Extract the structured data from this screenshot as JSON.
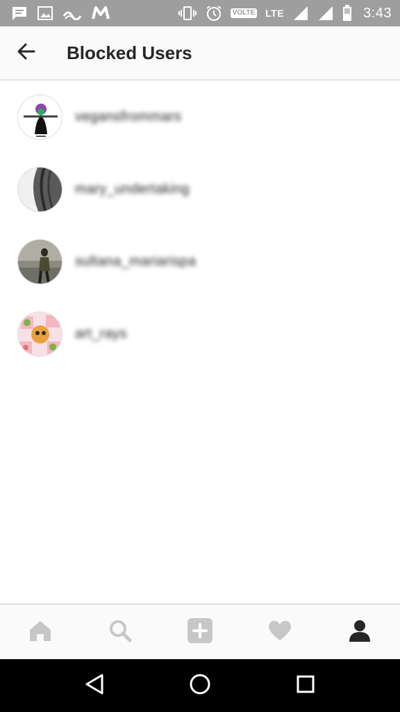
{
  "status_bar": {
    "volte": "VOLTE",
    "network": "LTE",
    "time": "3:43",
    "icons": [
      "message-icon",
      "image-icon",
      "wifi-signal-icon",
      "m-app-icon",
      "vibrate-icon",
      "alarm-icon",
      "signal-icon",
      "signal-icon-2",
      "battery-icon"
    ]
  },
  "app_bar": {
    "title": "Blocked Users",
    "back_icon": "back-arrow-icon"
  },
  "blocked_users": [
    {
      "username": "vegansfrommars",
      "avatar": "avatar-vegansfrommars"
    },
    {
      "username": "mary_undertaking",
      "avatar": "avatar-mary-undertaking"
    },
    {
      "username": "sultana_mariarispa",
      "avatar": "avatar-sultana"
    },
    {
      "username": "art_rays",
      "avatar": "avatar-art-rays"
    }
  ],
  "bottom_nav": {
    "items": [
      "home-icon",
      "search-icon",
      "add-post-icon",
      "heart-icon",
      "profile-icon"
    ],
    "active": "profile-icon"
  },
  "system_nav": {
    "items": [
      "back-triangle-icon",
      "home-circle-icon",
      "recents-square-icon"
    ]
  },
  "colors": {
    "status_bar": "#9e9e9e",
    "app_bar": "#fafafa",
    "text": "#262626",
    "inactive_icon": "#c7c7c7",
    "system_nav": "#000000"
  }
}
